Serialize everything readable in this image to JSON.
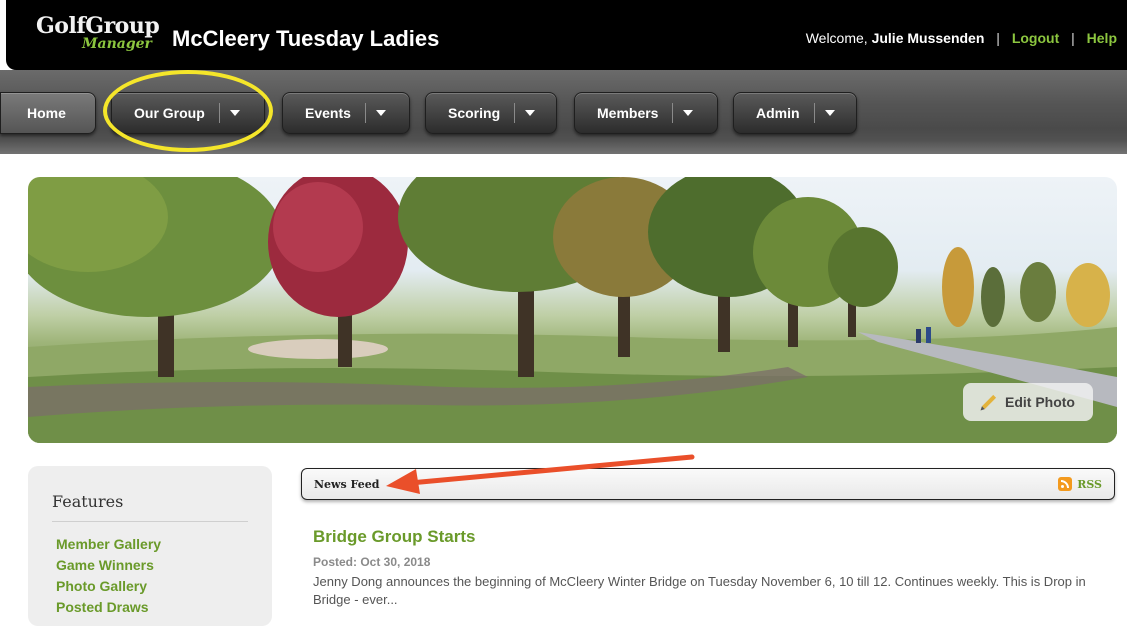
{
  "header": {
    "logo_top": "GolfGroup",
    "logo_bottom": "Manager",
    "group_title": "McCleery Tuesday Ladies",
    "welcome_prefix": "Welcome,",
    "user_name": "Julie Mussenden",
    "logout_label": "Logout",
    "help_label": "Help",
    "separator": "|"
  },
  "nav": {
    "items": [
      {
        "label": "Home"
      },
      {
        "label": "Our Group"
      },
      {
        "label": "Events"
      },
      {
        "label": "Scoring"
      },
      {
        "label": "Members"
      },
      {
        "label": "Admin"
      }
    ]
  },
  "banner": {
    "edit_label": "Edit Photo"
  },
  "sidebar": {
    "title": "Features",
    "items": [
      "Member Gallery",
      "Game Winners",
      "Photo Gallery",
      "Posted Draws"
    ]
  },
  "news": {
    "title": "News Feed",
    "rss_label": "RSS",
    "post": {
      "title": "Bridge Group Starts",
      "date": "Posted: Oct 30, 2018",
      "body": "Jenny Dong announces the beginning of McCleery Winter Bridge on Tuesday November 6, 10 till 12. Continues weekly. This is Drop in Bridge - ever..."
    }
  },
  "colors": {
    "accent_green": "#6a9a2a",
    "highlight_yellow": "#f5e62a",
    "annotation_arrow": "#ea4f2a"
  }
}
